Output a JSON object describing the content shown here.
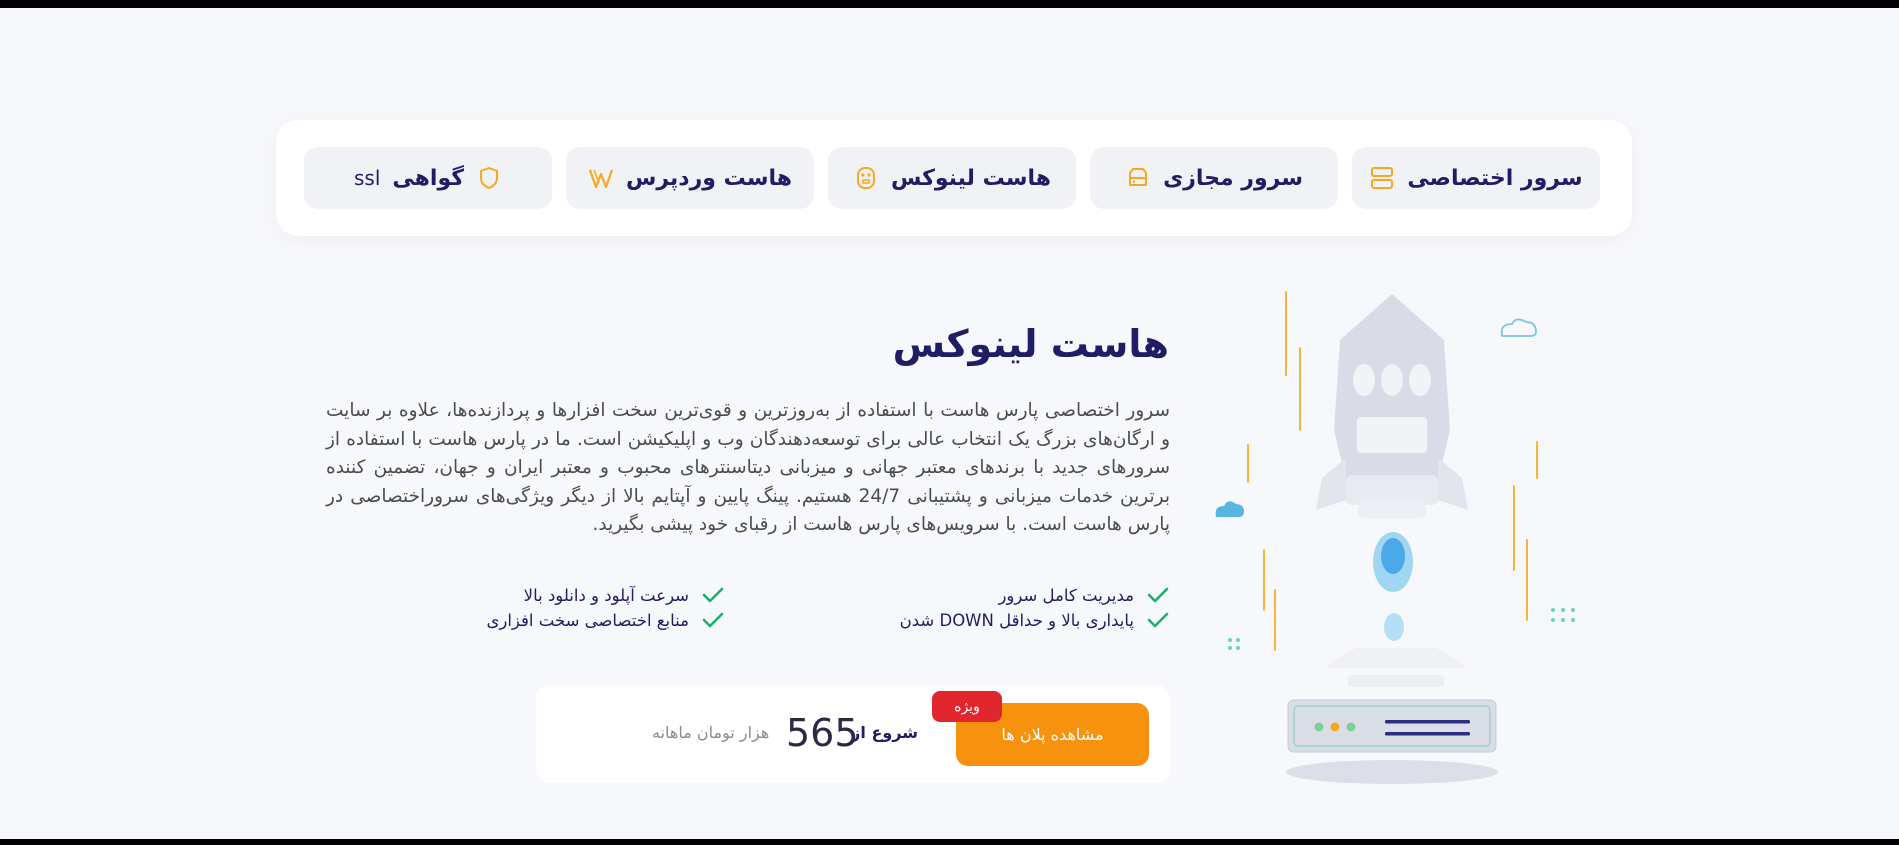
{
  "tabs": [
    {
      "label": "سرور اختصاصی",
      "icon": "server-stack-icon"
    },
    {
      "label": "سرور مجازی",
      "icon": "hard-drive-icon"
    },
    {
      "label": "هاست لینوکس",
      "icon": "linux-penguin-icon"
    },
    {
      "label": "هاست وردپرس",
      "icon": "wordpress-icon"
    },
    {
      "label": "گواهی",
      "icon": "shield-icon",
      "suffix": "ssl"
    }
  ],
  "section": {
    "title": "هاست لینوکس",
    "description": "سرور اختصاصی پارس هاست با استفاده از به‌روزترین و قوی‌ترین سخت افزارها و پردازنده‌ها، علاوه بر سایت و ارگان‌های بزرگ یک انتخاب عالی برای توسعه‌دهندگان وب و اپلیکیشن است. ما در پارس هاست با استفاده از سرورهای جدید با برندهای معتبر جهانی و میزبانی دیتاسنترهای محبوب و معتبر ایران و جهان، تضمین کننده برترین خدمات میزبانی و پشتیبانی 24/7 هستیم. پینگ پایین و آپتایم بالا از دیگر ویژگی‌های سروراختصاصی در پارس هاست است. با سرویس‌های پارس هاست از رقبای خود پیشی بگیرید."
  },
  "features": [
    "مدیریت کامل سرور",
    "سرعت آپلود و دانلود بالا",
    "پایداری بالا و حداقل DOWN شدن",
    "منابع اختصاصی سخت افزاری"
  ],
  "pricing": {
    "cta_label": "مشاهده پلان ها",
    "badge": "ویژه",
    "from_label": "شروع از",
    "price": "565",
    "unit": "هزار تومان ماهانه"
  },
  "colors": {
    "brand_navy": "#1f1d63",
    "accent_orange": "#f7920f",
    "badge_red": "#e1262d",
    "check_green": "#1cb06a"
  }
}
